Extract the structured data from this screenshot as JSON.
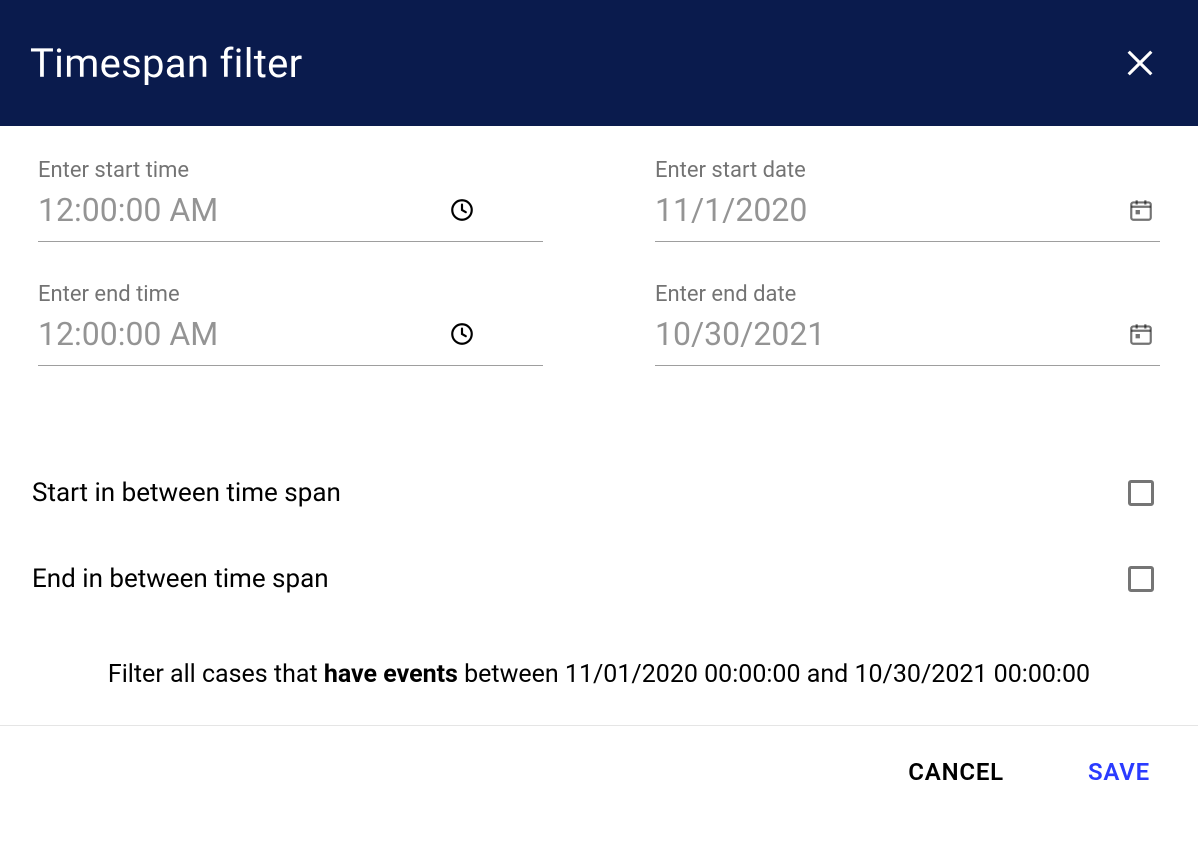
{
  "header": {
    "title": "Timespan filter"
  },
  "fields": {
    "start_time": {
      "label": "Enter start time",
      "value": "12:00:00 AM"
    },
    "start_date": {
      "label": "Enter start date",
      "value": "11/1/2020"
    },
    "end_time": {
      "label": "Enter end time",
      "value": "12:00:00 AM"
    },
    "end_date": {
      "label": "Enter end date",
      "value": "10/30/2021"
    }
  },
  "options": {
    "start_in_between": {
      "label": "Start in between time span",
      "checked": false
    },
    "end_in_between": {
      "label": "End in between time span",
      "checked": false
    }
  },
  "summary": {
    "prefix": "Filter all cases that ",
    "bold": "have events",
    "suffix": " between 11/01/2020 00:00:00 and 10/30/2021 00:00:00"
  },
  "footer": {
    "cancel": "CANCEL",
    "save": "SAVE"
  }
}
